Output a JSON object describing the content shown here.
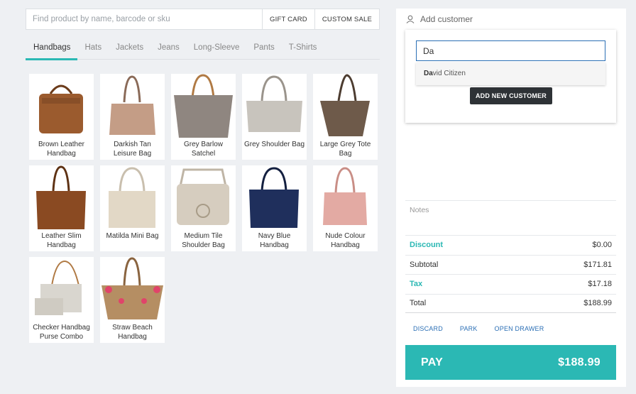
{
  "search": {
    "placeholder": "Find product by name, barcode or sku",
    "gift_card": "GIFT CARD",
    "custom_sale": "CUSTOM SALE"
  },
  "tabs": [
    "Handbags",
    "Hats",
    "Jackets",
    "Jeans",
    "Long-Sleeve",
    "Pants",
    "T-Shirts"
  ],
  "active_tab": "Handbags",
  "products": [
    {
      "name": "Brown Leather Handbag",
      "color": "#9b5b2e"
    },
    {
      "name": "Darkish Tan Leisure Bag",
      "color": "#c49d86"
    },
    {
      "name": "Grey Barlow Satchel",
      "color": "#8f8680"
    },
    {
      "name": "Grey Shoulder Bag",
      "color": "#c8c4bd"
    },
    {
      "name": "Large Grey Tote Bag",
      "color": "#6e5a4a"
    },
    {
      "name": "Leather Slim Handbag",
      "color": "#8a4a22"
    },
    {
      "name": "Matilda Mini Bag",
      "color": "#e2d8c6"
    },
    {
      "name": "Medium Tile Shoulder Bag",
      "color": "#d6cdbf"
    },
    {
      "name": "Navy Blue Handbag",
      "color": "#1f2f5c"
    },
    {
      "name": "Nude Colour Handbag",
      "color": "#e3aaa3"
    },
    {
      "name": "Checker Handbag Purse Combo",
      "color": "#d9d6cf"
    },
    {
      "name": "Straw Beach Handbag",
      "color": "#b58e63"
    }
  ],
  "customer": {
    "label": "Add customer",
    "input_value": "Da",
    "suggestion_match": "Da",
    "suggestion_rest": "vid Citizen",
    "add_new": "ADD NEW CUSTOMER"
  },
  "notes_label": "Notes",
  "totals": {
    "discount_label": "Discount",
    "discount": "$0.00",
    "subtotal_label": "Subtotal",
    "subtotal": "$171.81",
    "tax_label": "Tax",
    "tax": "$17.18",
    "total_label": "Total",
    "total": "$188.99"
  },
  "actions": {
    "discard": "DISCARD",
    "park": "PARK",
    "open_drawer": "OPEN DRAWER"
  },
  "pay": {
    "label": "PAY",
    "amount": "$188.99"
  },
  "colors": {
    "accent": "#2bb8b4",
    "link": "#2b6fb5",
    "dark_button": "#2e3236"
  }
}
